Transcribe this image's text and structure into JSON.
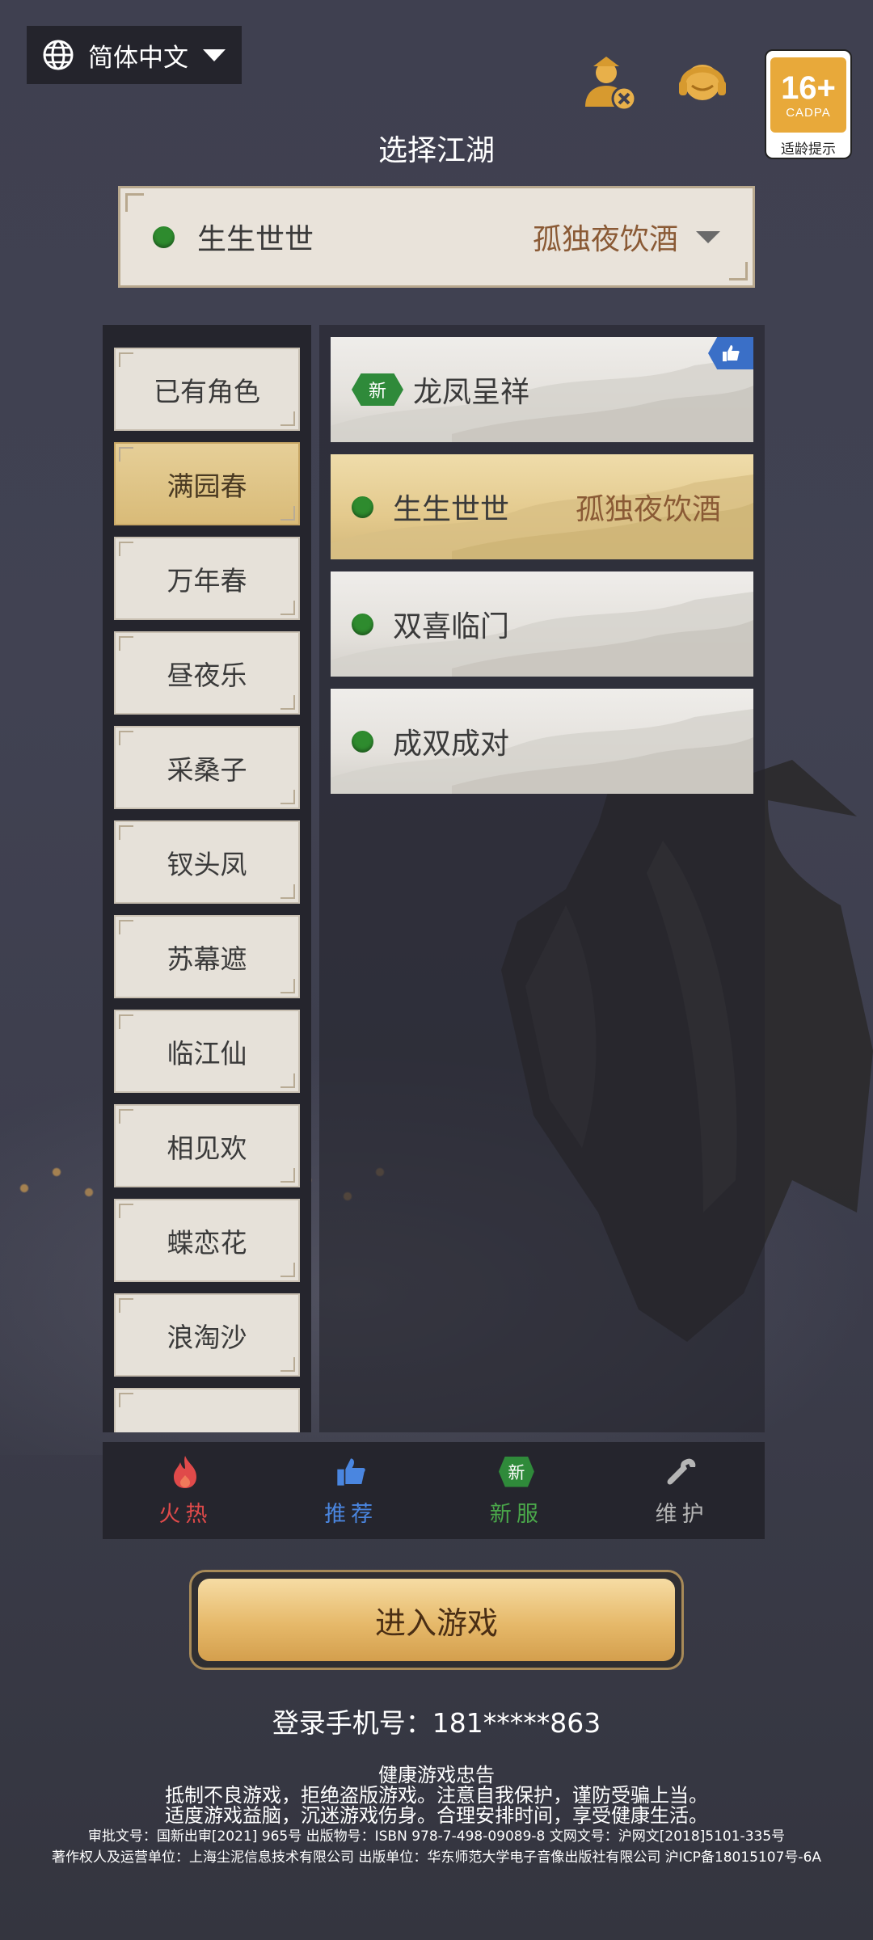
{
  "topbar": {
    "language": "简体中文",
    "age_rating": {
      "number": "16+",
      "org": "CADPA",
      "label": "适龄提示"
    }
  },
  "page_title": "选择江湖",
  "selected_server": {
    "status": "online",
    "name": "生生世世",
    "server_name": "孤独夜饮酒"
  },
  "categories": [
    {
      "label": "已有角色",
      "active": false
    },
    {
      "label": "满园春",
      "active": true
    },
    {
      "label": "万年春",
      "active": false
    },
    {
      "label": "昼夜乐",
      "active": false
    },
    {
      "label": "采桑子",
      "active": false
    },
    {
      "label": "钗头凤",
      "active": false
    },
    {
      "label": "苏幕遮",
      "active": false
    },
    {
      "label": "临江仙",
      "active": false
    },
    {
      "label": "相见欢",
      "active": false
    },
    {
      "label": "蝶恋花",
      "active": false
    },
    {
      "label": "浪淘沙",
      "active": false
    }
  ],
  "servers": [
    {
      "badge": "新",
      "name": "龙凤呈祥",
      "extra": "",
      "recommended": true
    },
    {
      "status": "online",
      "name": "生生世世",
      "extra": "孤独夜饮酒",
      "active": true
    },
    {
      "status": "online",
      "name": "双喜临门",
      "extra": ""
    },
    {
      "status": "online",
      "name": "成双成对",
      "extra": ""
    }
  ],
  "tabs": [
    {
      "label": "火热",
      "icon": "flame-icon",
      "color": "#e04a4a"
    },
    {
      "label": "推荐",
      "icon": "thumbs-up-icon",
      "color": "#4a86e0"
    },
    {
      "label": "新服",
      "icon": "new-badge-icon",
      "color": "#4aa84a"
    },
    {
      "label": "维护",
      "icon": "wrench-icon",
      "color": "#b5b5b5"
    }
  ],
  "enter_button": "进入游戏",
  "phone_login": "登录手机号：181*****863",
  "notice": {
    "title": "健康游戏忠告",
    "line1": "抵制不良游戏，拒绝盗版游戏。注意自我保护，谨防受骗上当。",
    "line2": "适度游戏益脑，沉迷游戏伤身。合理安排时间，享受健康生活。",
    "line3": "审批文号：国新出审[2021] 965号    出版物号：ISBN 978-7-498-09089-8    文网文号：沪网文[2018]5101-335号",
    "line4": "著作权人及运营单位：上海尘泥信息技术有限公司    出版单位：华东师范大学电子音像出版社有限公司    沪ICP备18015107号-6A"
  },
  "colors": {
    "online": "#2e8b2e",
    "accent_gold": "#e6b96a",
    "server_brown": "#8a5a35"
  }
}
